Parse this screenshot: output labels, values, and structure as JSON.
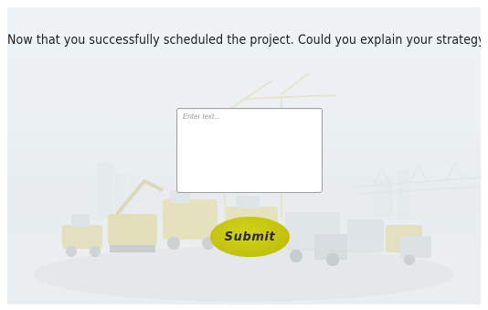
{
  "question": {
    "text": "Now that you successfully scheduled the project. Could you explain your strategy?"
  },
  "answer": {
    "placeholder": "Enter text...",
    "value": ""
  },
  "submit": {
    "label": "Submit",
    "color": "#c8c812"
  },
  "background": {
    "description_icon": "construction-equipment-illustration"
  }
}
